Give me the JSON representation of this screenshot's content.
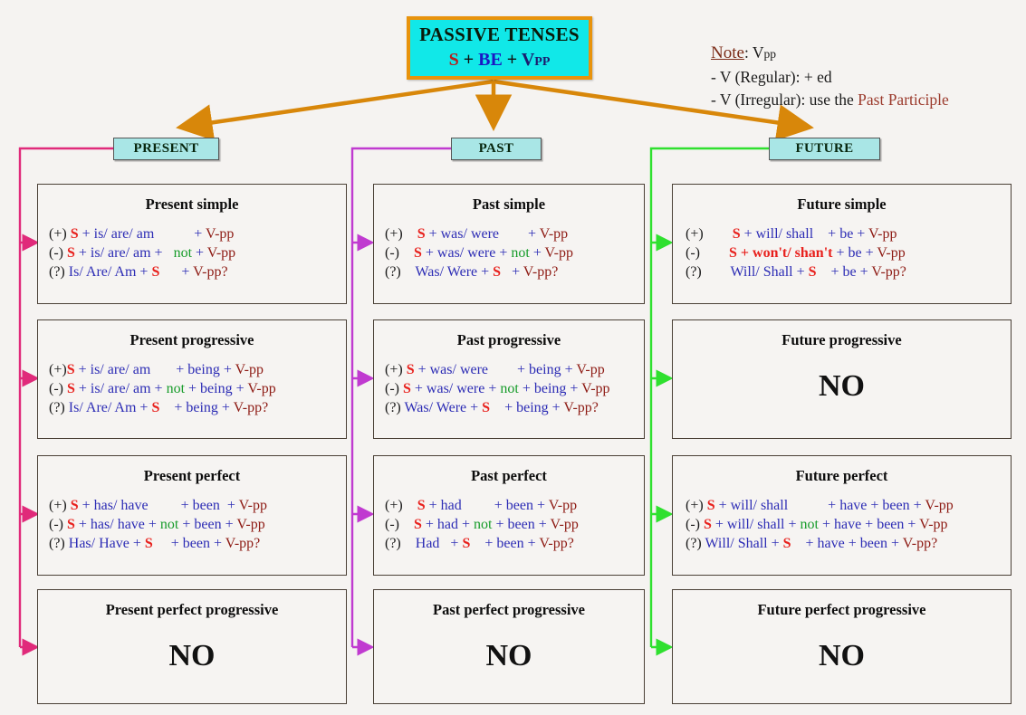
{
  "title": {
    "main": "PASSIVE TENSES",
    "formula_s": "S",
    "formula_plus1": " + ",
    "formula_be": "BE",
    "formula_plus2": " + ",
    "formula_v": "V",
    "formula_pp": "PP"
  },
  "note": {
    "label": "Note",
    "colon_vpp": ": V",
    "vpp_sub": "pp",
    "line_regular": "- V (Regular):  + ed",
    "line_irregular_prefix": "- V (Irregular): use the ",
    "line_irregular_highlight": "Past Participle"
  },
  "columns": [
    {
      "header": "PRESENT",
      "accent": "#e02a7a"
    },
    {
      "header": "PAST",
      "accent": "#c03ad0"
    },
    {
      "header": "FUTURE",
      "accent": "#2fe02f"
    }
  ],
  "boxes": {
    "present_simple": {
      "title": "Present simple",
      "rows": [
        {
          "mark": "(+) ",
          "subject": "S",
          "aux": " + is/ are/ am",
          "pad": "          ",
          "not": "",
          "mid": "",
          "tail": " + ",
          "vpp": "V-pp"
        },
        {
          "mark": "(-) ",
          "subject": "S",
          "aux": " + is/ are/ am + ",
          "pad": "  ",
          "not": "not",
          "mid": "",
          "tail": " + ",
          "vpp": "V-pp"
        },
        {
          "mark": "(?) ",
          "subject": "",
          "aux": "Is/ Are/ Am + ",
          "pad": "",
          "not": "",
          "mid": "S",
          "tail": "      + ",
          "vpp": "V-pp?"
        }
      ]
    },
    "present_progressive": {
      "title": "Present progressive",
      "rows": [
        {
          "mark": "(+)",
          "subject": "S",
          "aux": " + is/ are/ am",
          "pad": "      ",
          "not": "",
          "mid": "",
          "tail": " + being + ",
          "vpp": "V-pp"
        },
        {
          "mark": "(-) ",
          "subject": "S",
          "aux": " + is/ are/ am + ",
          "pad": "",
          "not": "not",
          "mid": "",
          "tail": " + being + ",
          "vpp": "V-pp"
        },
        {
          "mark": "(?) ",
          "subject": "",
          "aux": "Is/ Are/ Am + ",
          "pad": "",
          "not": "",
          "mid": "S",
          "tail": "    + being + ",
          "vpp": "V-pp?"
        }
      ]
    },
    "present_perfect": {
      "title": "Present perfect",
      "rows": [
        {
          "mark": "(+) ",
          "subject": "S",
          "aux": " + has/ have",
          "pad": "        ",
          "not": "",
          "mid": "",
          "tail": " + been  + ",
          "vpp": "V-pp"
        },
        {
          "mark": "(-) ",
          "subject": "S",
          "aux": " + has/ have + ",
          "pad": "",
          "not": "not",
          "mid": "",
          "tail": " + been + ",
          "vpp": "V-pp"
        },
        {
          "mark": "(?) ",
          "subject": "",
          "aux": "Has/ Have + ",
          "pad": "",
          "not": "",
          "mid": "S",
          "tail": "     + been + ",
          "vpp": "V-pp?"
        }
      ]
    },
    "present_perfect_progressive": {
      "title": "Present perfect progressive",
      "no": "NO"
    },
    "past_simple": {
      "title": "Past simple",
      "rows": [
        {
          "mark": "(+)    ",
          "subject": "S",
          "aux": " + was/ were",
          "pad": "       ",
          "not": "",
          "mid": "",
          "tail": " + ",
          "vpp": "V-pp"
        },
        {
          "mark": "(-)    ",
          "subject": "S",
          "aux": " + was/ were + ",
          "pad": "",
          "not": "not",
          "mid": "",
          "tail": " + ",
          "vpp": "V-pp"
        },
        {
          "mark": "(?)    ",
          "subject": "",
          "aux": "Was/ Were + ",
          "pad": "",
          "not": "",
          "mid": "S",
          "tail": "   + ",
          "vpp": "V-pp?"
        }
      ]
    },
    "past_progressive": {
      "title": "Past progressive",
      "rows": [
        {
          "mark": "(+) ",
          "subject": "S",
          "aux": " + was/ were",
          "pad": "       ",
          "not": "",
          "mid": "",
          "tail": " + being + ",
          "vpp": "V-pp"
        },
        {
          "mark": "(-) ",
          "subject": "S",
          "aux": " + was/ were + ",
          "pad": "",
          "not": "not",
          "mid": "",
          "tail": " + being + ",
          "vpp": "V-pp"
        },
        {
          "mark": "(?) ",
          "subject": "",
          "aux": "Was/ Were + ",
          "pad": "",
          "not": "",
          "mid": "S",
          "tail": "    + being + ",
          "vpp": "V-pp?"
        }
      ]
    },
    "past_perfect": {
      "title": "Past perfect",
      "rows": [
        {
          "mark": "(+)    ",
          "subject": "S",
          "aux": " + had",
          "pad": "        ",
          "not": "",
          "mid": "",
          "tail": " + been + ",
          "vpp": "V-pp"
        },
        {
          "mark": "(-)    ",
          "subject": "S",
          "aux": " + had + ",
          "pad": "",
          "not": "not",
          "mid": "",
          "tail": " + been + ",
          "vpp": "V-pp"
        },
        {
          "mark": "(?)    ",
          "subject": "",
          "aux": "Had   + ",
          "pad": "",
          "not": "",
          "mid": "S",
          "tail": "    + been + ",
          "vpp": "V-pp?"
        }
      ]
    },
    "past_perfect_progressive": {
      "title": "Past perfect progressive",
      "no": "NO"
    },
    "future_simple": {
      "title": "Future simple",
      "rows": [
        {
          "mark": "(+)        ",
          "subject": "S",
          "aux": " + will/ shall",
          "pad": "   ",
          "not": "",
          "mid": "",
          "tail": " + be + ",
          "vpp": "V-pp"
        },
        {
          "mark": "(-)        ",
          "subject": "S",
          "aux2": " + won't/ shan't",
          "pad": "",
          "not": "",
          "mid": "",
          "tail": " + be + ",
          "vpp": "V-pp"
        },
        {
          "mark": "(?)        ",
          "subject": "",
          "aux": "Will/ Shall + ",
          "pad": "",
          "not": "",
          "mid": "S",
          "tail": "    + be + ",
          "vpp": "V-pp?"
        }
      ]
    },
    "future_progressive": {
      "title": "Future progressive",
      "no": "NO"
    },
    "future_perfect": {
      "title": "Future perfect",
      "rows": [
        {
          "mark": "(+) ",
          "subject": "S",
          "aux": " + will/ shall",
          "pad": "          ",
          "not": "",
          "mid": "",
          "tail": " + have + been + ",
          "vpp": "V-pp"
        },
        {
          "mark": "(-) ",
          "subject": "S",
          "aux": " + will/ shall + ",
          "pad": "",
          "not": "not",
          "mid": "",
          "tail": " + have + been + ",
          "vpp": "V-pp"
        },
        {
          "mark": "(?) ",
          "subject": "",
          "aux": "Will/ Shall + ",
          "pad": "",
          "not": "",
          "mid": "S",
          "tail": "    + have + been + ",
          "vpp": "V-pp?"
        }
      ]
    },
    "future_perfect_progressive": {
      "title": "Future perfect progressive",
      "no": "NO"
    }
  },
  "colors": {
    "title_bg": "#11e8e8",
    "title_border": "#e8930c",
    "header_bg": "#a9e6e6",
    "arrow_orange": "#e8930c",
    "present_line": "#e02a7a",
    "past_line": "#c03ad0",
    "future_line": "#2fe02f",
    "subject_red": "#e8211d",
    "aux_blue": "#2d2db5",
    "not_green": "#179c2a",
    "vpp_maroon": "#8d1a13"
  }
}
